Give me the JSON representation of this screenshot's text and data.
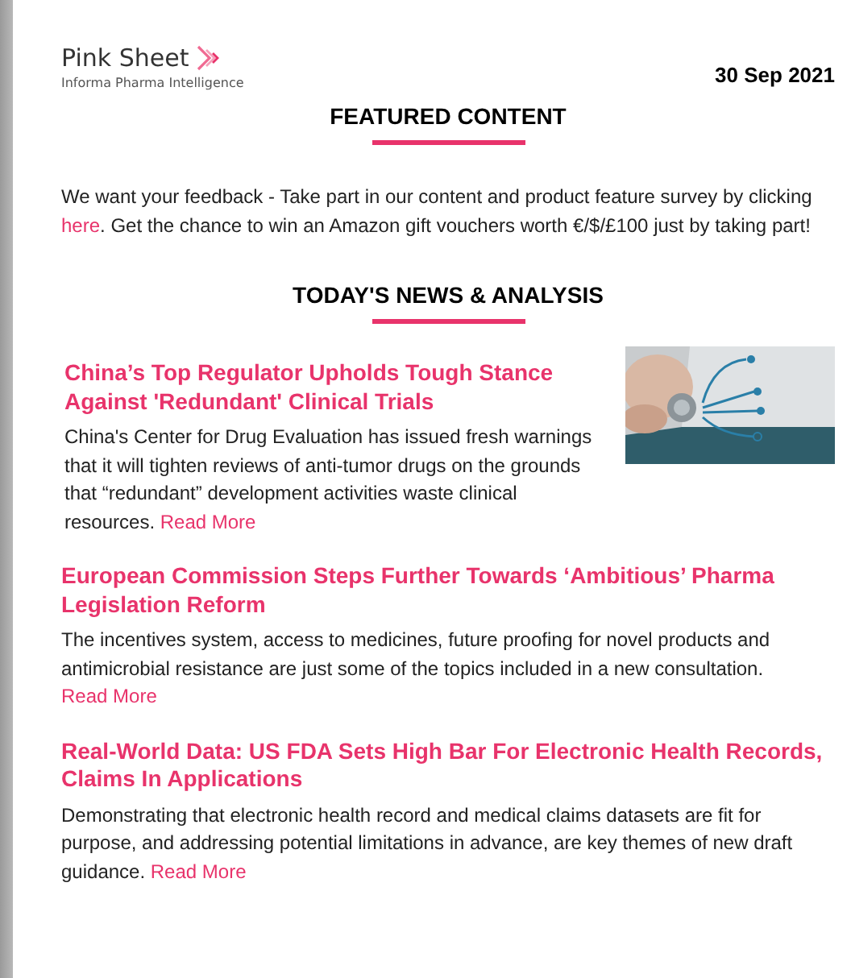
{
  "header": {
    "logo_title": "Pink Sheet",
    "logo_subtitle": "Informa Pharma Intelligence",
    "date": "30 Sep 2021"
  },
  "featured": {
    "heading": "FEATURED CONTENT",
    "text_before": "We want your feedback - Take part in our content and product feature survey by clicking ",
    "link": "here",
    "text_after": ". Get the chance to win an Amazon gift vouchers worth €/$/£100 just by taking part!"
  },
  "news": {
    "heading": "TODAY'S NEWS & ANALYSIS",
    "articles": [
      {
        "title": "China’s Top Regulator Upholds Tough Stance Against 'Redundant' Clinical Trials",
        "summary": "China's Center for Drug Evaluation has issued fresh warnings that it will tighten reviews of anti-tumor drugs on the grounds that “redundant” development activities waste clinical resources.",
        "link": "Read More"
      },
      {
        "title": "European Commission Steps Further Towards ‘Ambitious’ Pharma Legislation Reform",
        "summary": "The incentives system, access to medicines, future proofing for novel products and antimicrobial resistance are just some of the topics included in a new consultation.",
        "link": "Read More"
      },
      {
        "title": "Real-World Data: US FDA Sets High Bar For Electronic Health Records, Claims In Applications",
        "summary": "Demonstrating that electronic health record and medical claims datasets are fit for purpose, and addressing potential limitations in advance, are key themes of new draft guidance.",
        "link": "Read More"
      }
    ]
  }
}
